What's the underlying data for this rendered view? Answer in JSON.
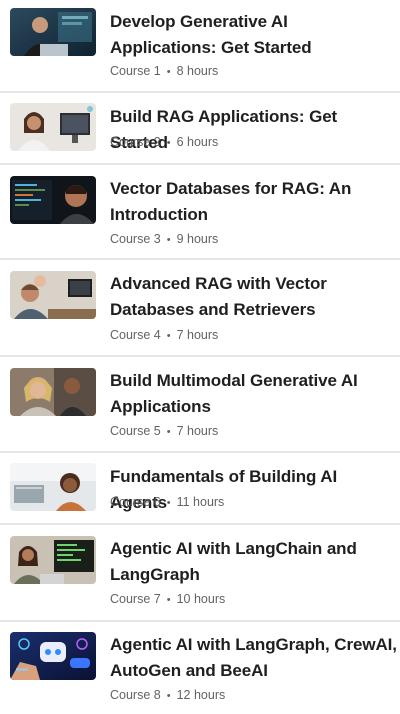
{
  "courses": [
    {
      "title": "Develop Generative AI Applications: Get Started",
      "course_label": "Course 1",
      "separator": "•",
      "duration": "8 hours",
      "thumbnail_icon": "person-with-laptop-photo"
    },
    {
      "title": "Build RAG Applications: Get Started",
      "course_label": "Course 2",
      "separator": "•",
      "duration": "6 hours",
      "thumbnail_icon": "woman-at-monitor-photo"
    },
    {
      "title": "Vector Databases for RAG: An Introduction",
      "course_label": "Course 3",
      "separator": "•",
      "duration": "9 hours",
      "thumbnail_icon": "man-with-code-screen-photo"
    },
    {
      "title": "Advanced RAG with Vector Databases and Retrievers",
      "course_label": "Course 4",
      "separator": "•",
      "duration": "7 hours",
      "thumbnail_icon": "man-at-desk-photo"
    },
    {
      "title": "Build Multimodal Generative AI Applications",
      "course_label": "Course 5",
      "separator": "•",
      "duration": "7 hours",
      "thumbnail_icon": "smiling-team-photo"
    },
    {
      "title": "Fundamentals of Building AI Agents",
      "course_label": "Course 6",
      "separator": "•",
      "duration": "11 hours",
      "thumbnail_icon": "woman-in-office-photo"
    },
    {
      "title": "Agentic AI with LangChain and LangGraph",
      "course_label": "Course 7",
      "separator": "•",
      "duration": "10 hours",
      "thumbnail_icon": "woman-with-laptop-photo"
    },
    {
      "title": "Agentic AI with LangGraph, CrewAI, AutoGen and BeeAI",
      "course_label": "Course 8",
      "separator": "•",
      "duration": "12 hours",
      "thumbnail_icon": "robot-chat-illustration"
    }
  ]
}
